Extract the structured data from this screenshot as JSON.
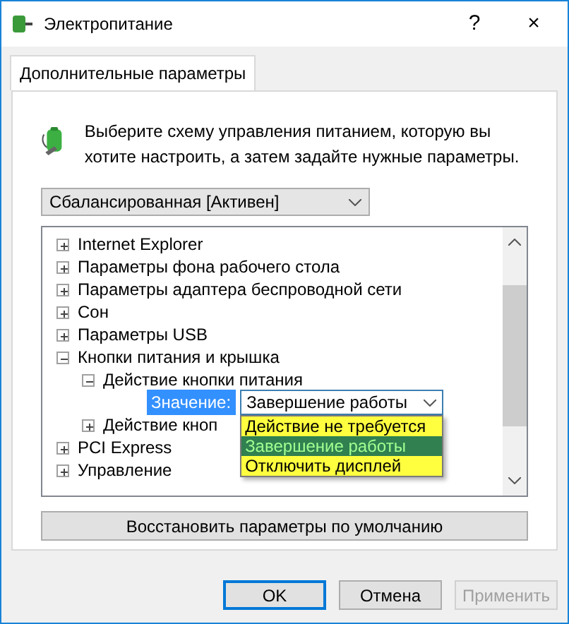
{
  "window": {
    "title": "Электропитание",
    "help": "?",
    "close": "×"
  },
  "tabs": [
    {
      "label": "Дополнительные параметры",
      "selected": true
    }
  ],
  "intro": "Выберите схему управления питанием, которую вы хотите настроить, а затем задайте нужные параметры.",
  "scheme": {
    "value": "Сбалансированная [Активен]"
  },
  "tree": [
    {
      "label": "Internet Explorer",
      "expanded": false
    },
    {
      "label": "Параметры фона рабочего стола",
      "expanded": false
    },
    {
      "label": "Параметры адаптера беспроводной сети",
      "expanded": false
    },
    {
      "label": "Сон",
      "expanded": false
    },
    {
      "label": "Параметры USB",
      "expanded": false
    },
    {
      "label": "Кнопки питания и крышка",
      "expanded": true,
      "children": [
        {
          "label": "Действие кнопки питания",
          "expanded": true,
          "setting": {
            "label": "Значение:",
            "value": "Завершение работы",
            "options": [
              {
                "label": "Действие не требуется",
                "selected": false
              },
              {
                "label": "Завершение работы",
                "selected": true
              },
              {
                "label": "Отключить дисплей",
                "selected": false
              }
            ]
          }
        },
        {
          "label": "Действие кноп",
          "expanded": false
        }
      ]
    },
    {
      "label": "PCI Express",
      "expanded": false
    },
    {
      "label": "Управление",
      "expanded": false
    }
  ],
  "restore_button": "Восстановить параметры по умолчанию",
  "buttons": [
    {
      "label": "OK",
      "disabled": false,
      "default": true
    },
    {
      "label": "Отмена",
      "disabled": false,
      "default": false
    },
    {
      "label": "Применить",
      "disabled": true,
      "default": false
    }
  ]
}
